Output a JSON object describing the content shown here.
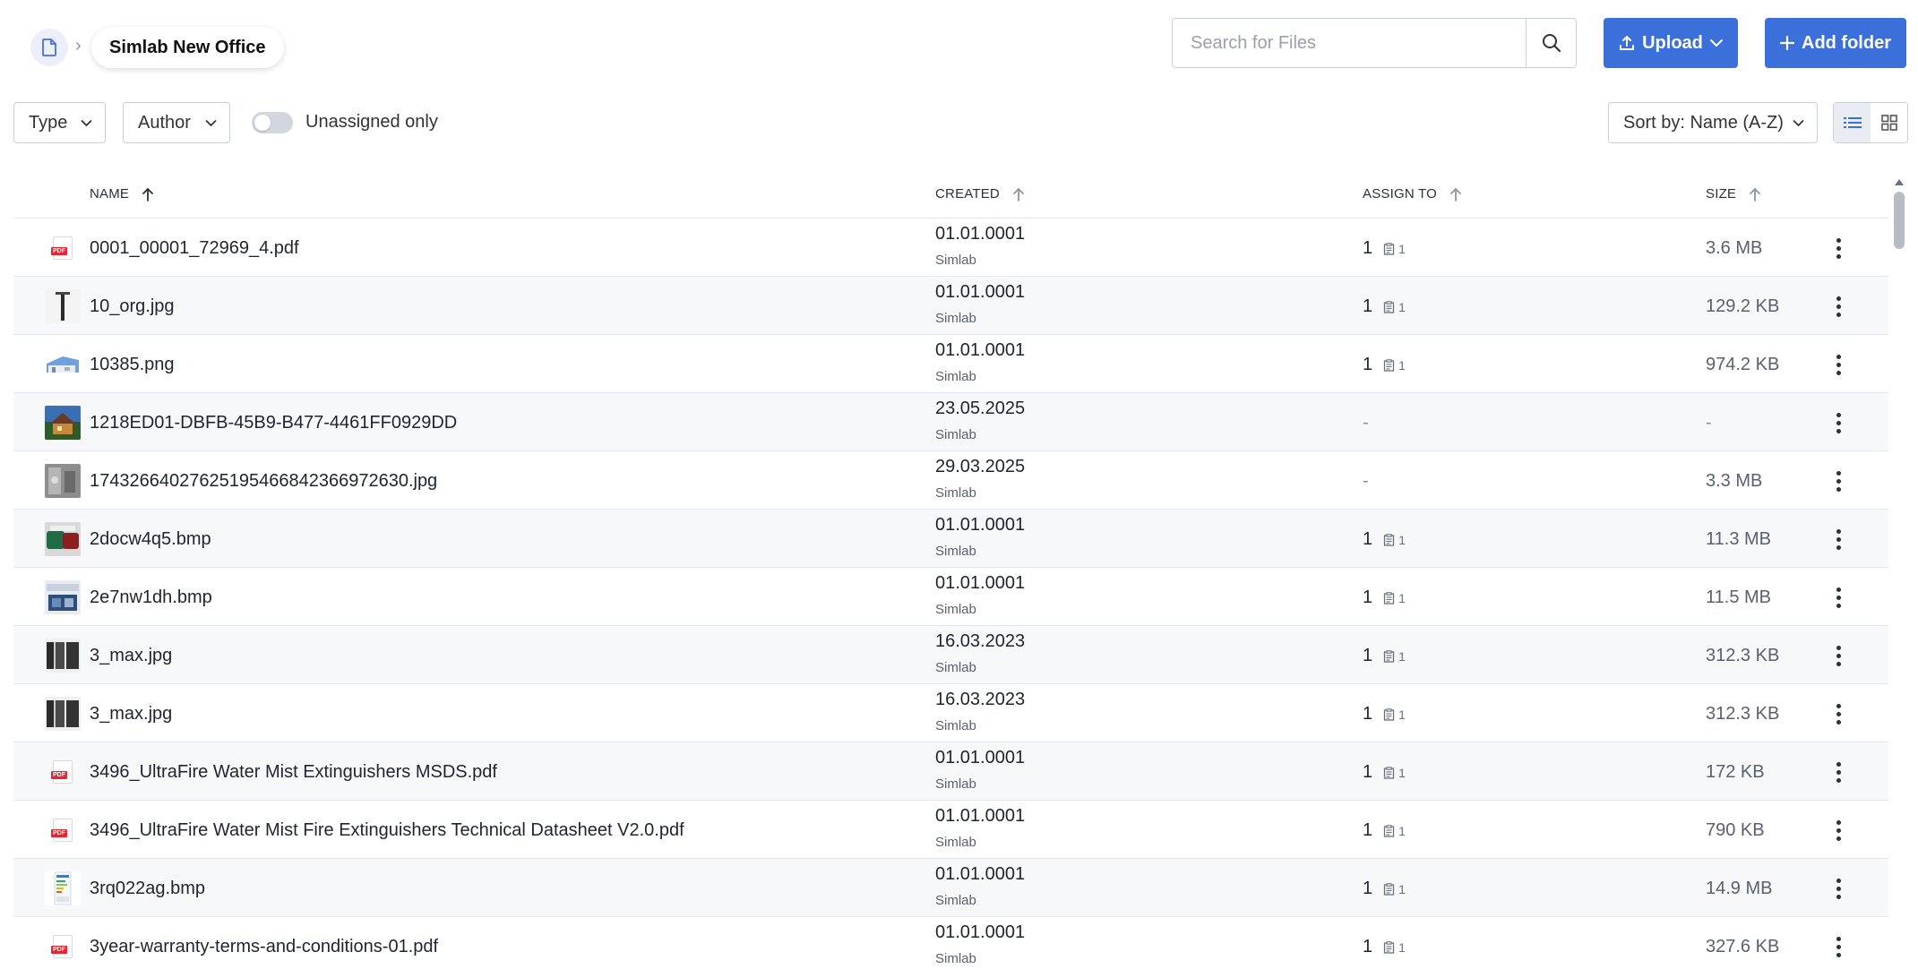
{
  "breadcrumb": {
    "current": "Simlab New Office"
  },
  "search": {
    "placeholder": "Search for Files"
  },
  "toolbar": {
    "upload_label": "Upload",
    "add_folder_label": "Add folder"
  },
  "filters": {
    "type_label": "Type",
    "author_label": "Author",
    "unassigned_label": "Unassigned only",
    "sort_label": "Sort by: Name (A-Z)"
  },
  "colors": {
    "accent": "#3b6fd9",
    "pdf": "#e3262f"
  },
  "table": {
    "headers": {
      "name": "NAME",
      "created": "CREATED",
      "assign": "ASSIGN TO",
      "size": "SIZE"
    },
    "rows": [
      {
        "thumb": "pdf",
        "name": "0001_00001_72969_4.pdf",
        "date": "01.01.0001",
        "author": "Simlab",
        "assign": "1",
        "assign_sub": "1",
        "size": "3.6 MB"
      },
      {
        "thumb": "pole",
        "name": "10_org.jpg",
        "date": "01.01.0001",
        "author": "Simlab",
        "assign": "1",
        "assign_sub": "1",
        "size": "129.2 KB"
      },
      {
        "thumb": "building",
        "name": "10385.png",
        "date": "01.01.0001",
        "author": "Simlab",
        "assign": "1",
        "assign_sub": "1",
        "size": "974.2 KB"
      },
      {
        "thumb": "photo-house",
        "name": "1218ED01-DBFB-45B9-B477-4461FF0929DD",
        "date": "23.05.2025",
        "author": "Simlab",
        "assign": "-",
        "assign_sub": "",
        "size": "-"
      },
      {
        "thumb": "photo-gray",
        "name": "1743266402762519546684236697​2630.jpg",
        "date": "29.03.2025",
        "author": "Simlab",
        "assign": "-",
        "assign_sub": "",
        "size": "3.3 MB"
      },
      {
        "thumb": "photo-green",
        "name": "2docw4q5.bmp",
        "date": "01.01.0001",
        "author": "Simlab",
        "assign": "1",
        "assign_sub": "1",
        "size": "11.3 MB"
      },
      {
        "thumb": "photo-blue",
        "name": "2e7nw1dh.bmp",
        "date": "01.01.0001",
        "author": "Simlab",
        "assign": "1",
        "assign_sub": "1",
        "size": "11.5 MB"
      },
      {
        "thumb": "panels",
        "name": "3_max.jpg",
        "date": "16.03.2023",
        "author": "Simlab",
        "assign": "1",
        "assign_sub": "1",
        "size": "312.3 KB"
      },
      {
        "thumb": "panels",
        "name": "3_max.jpg",
        "date": "16.03.2023",
        "author": "Simlab",
        "assign": "1",
        "assign_sub": "1",
        "size": "312.3 KB"
      },
      {
        "thumb": "pdf",
        "name": "3496_UltraFire Water Mist Extinguishers MSDS.pdf",
        "date": "01.01.0001",
        "author": "Simlab",
        "assign": "1",
        "assign_sub": "1",
        "size": "172 KB"
      },
      {
        "thumb": "pdf",
        "name": "3496_UltraFire Water Mist Fire Extinguishers Technical Datasheet V2.0.pdf",
        "date": "01.01.0001",
        "author": "Simlab",
        "assign": "1",
        "assign_sub": "1",
        "size": "790 KB"
      },
      {
        "thumb": "label",
        "name": "3rq022ag.bmp",
        "date": "01.01.0001",
        "author": "Simlab",
        "assign": "1",
        "assign_sub": "1",
        "size": "14.9 MB"
      },
      {
        "thumb": "pdf",
        "name": "3year-warranty-terms-and-conditions-01.pdf",
        "date": "01.01.0001",
        "author": "Simlab",
        "assign": "1",
        "assign_sub": "1",
        "size": "327.6 KB"
      }
    ]
  }
}
